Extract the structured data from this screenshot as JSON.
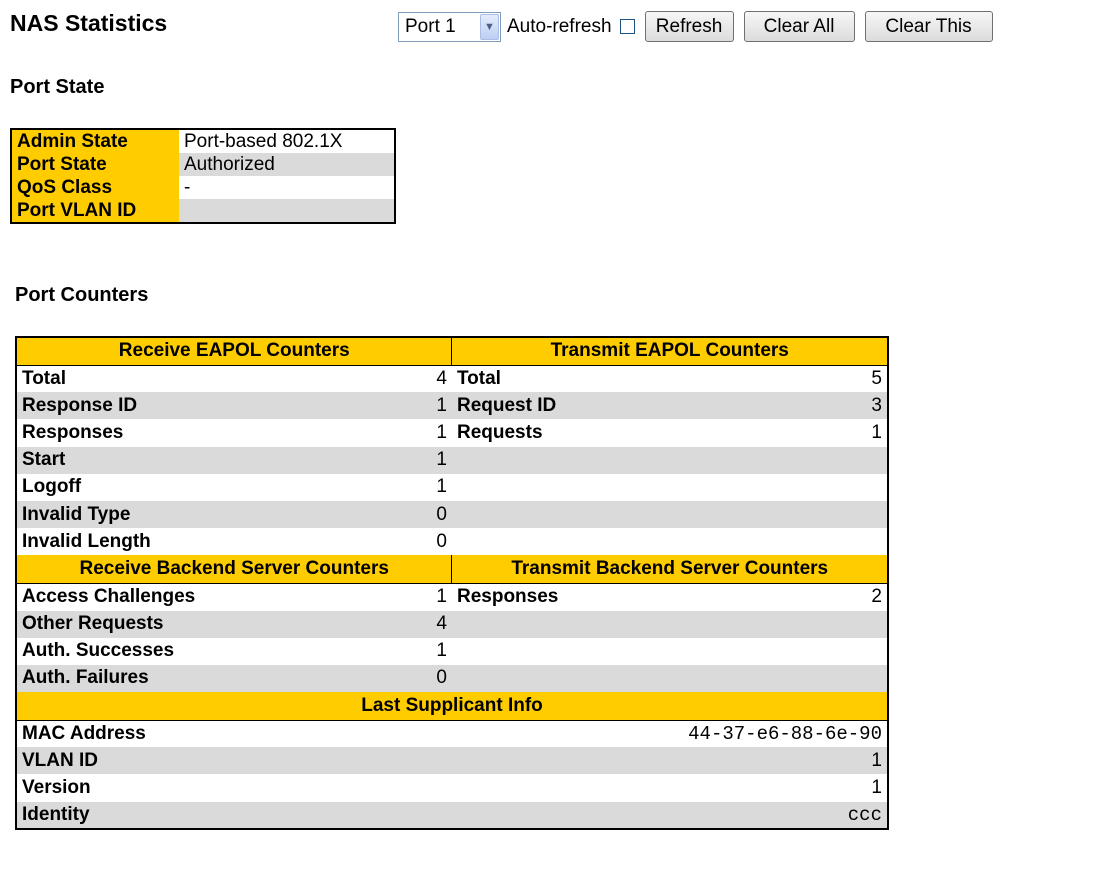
{
  "page": {
    "title": "NAS Statistics"
  },
  "toolbar": {
    "port_select": "Port 1",
    "auto_refresh_label": "Auto-refresh",
    "auto_refresh_checked": false,
    "refresh_label": "Refresh",
    "clear_all_label": "Clear All",
    "clear_this_label": "Clear This"
  },
  "port_state": {
    "title": "Port State",
    "rows": [
      {
        "label": "Admin State",
        "value": "Port-based 802.1X"
      },
      {
        "label": "Port State",
        "value": "Authorized"
      },
      {
        "label": "QoS Class",
        "value": "-"
      },
      {
        "label": "Port VLAN ID",
        "value": ""
      }
    ]
  },
  "port_counters": {
    "title": "Port Counters",
    "eapol": {
      "rx_header": "Receive EAPOL Counters",
      "tx_header": "Transmit EAPOL Counters",
      "rows": [
        {
          "rx_label": "Total",
          "rx_value": "4",
          "tx_label": "Total",
          "tx_value": "5"
        },
        {
          "rx_label": "Response ID",
          "rx_value": "1",
          "tx_label": "Request ID",
          "tx_value": "3"
        },
        {
          "rx_label": "Responses",
          "rx_value": "1",
          "tx_label": "Requests",
          "tx_value": "1"
        },
        {
          "rx_label": "Start",
          "rx_value": "1",
          "tx_label": "",
          "tx_value": ""
        },
        {
          "rx_label": "Logoff",
          "rx_value": "1",
          "tx_label": "",
          "tx_value": ""
        },
        {
          "rx_label": "Invalid Type",
          "rx_value": "0",
          "tx_label": "",
          "tx_value": ""
        },
        {
          "rx_label": "Invalid Length",
          "rx_value": "0",
          "tx_label": "",
          "tx_value": ""
        }
      ]
    },
    "backend": {
      "rx_header": "Receive Backend Server Counters",
      "tx_header": "Transmit Backend Server Counters",
      "rows": [
        {
          "rx_label": "Access Challenges",
          "rx_value": "1",
          "tx_label": "Responses",
          "tx_value": "2"
        },
        {
          "rx_label": "Other Requests",
          "rx_value": "4",
          "tx_label": "",
          "tx_value": ""
        },
        {
          "rx_label": "Auth. Successes",
          "rx_value": "1",
          "tx_label": "",
          "tx_value": ""
        },
        {
          "rx_label": "Auth. Failures",
          "rx_value": "0",
          "tx_label": "",
          "tx_value": ""
        }
      ]
    },
    "supplicant": {
      "header": "Last Supplicant Info",
      "rows": [
        {
          "label": "MAC Address",
          "value": "44-37-e6-88-6e-90"
        },
        {
          "label": "VLAN ID",
          "value": "1"
        },
        {
          "label": "Version",
          "value": "1"
        },
        {
          "label": "Identity",
          "value": "ccc"
        }
      ]
    }
  }
}
